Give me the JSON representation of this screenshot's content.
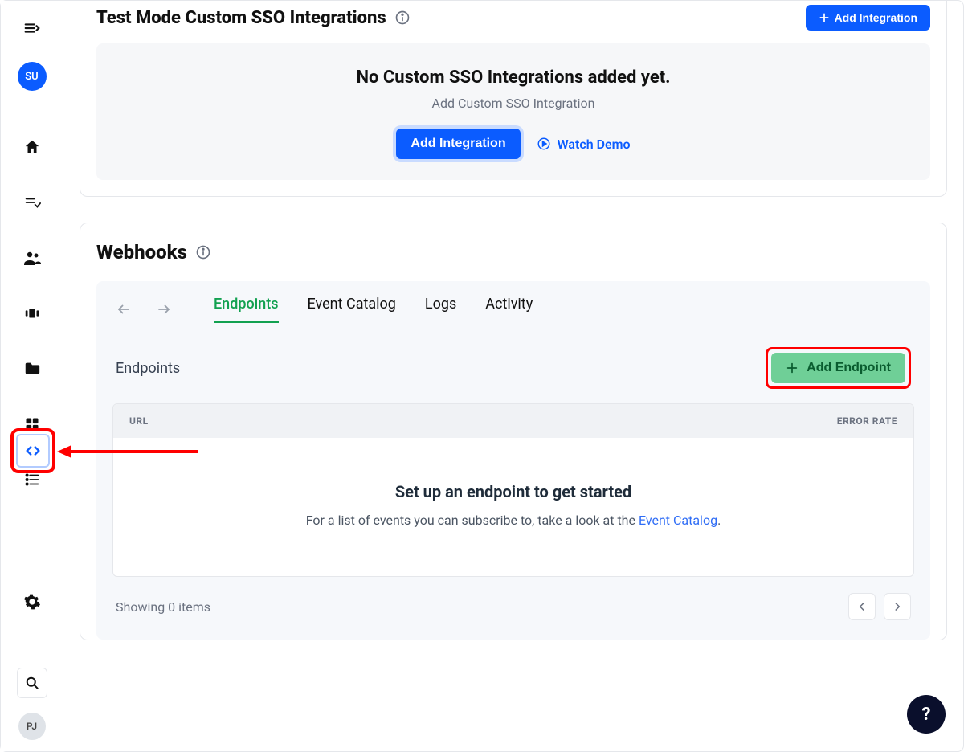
{
  "sidebar": {
    "avatar_top": "SU",
    "avatar_bottom": "PJ"
  },
  "sso": {
    "title": "Test Mode Custom SSO Integrations",
    "add_btn_top": "Add Integration",
    "empty_title": "No Custom SSO Integrations added yet.",
    "empty_sub": "Add Custom SSO Integration",
    "add_btn": "Add Integration",
    "watch_demo": "Watch Demo"
  },
  "webhooks": {
    "title": "Webhooks",
    "tabs": {
      "endpoints": "Endpoints",
      "event_catalog": "Event Catalog",
      "logs": "Logs",
      "activity": "Activity"
    },
    "endpoints_heading": "Endpoints",
    "add_endpoint": "Add Endpoint",
    "table": {
      "col_url": "URL",
      "col_error_rate": "ERROR RATE",
      "empty_title": "Set up an endpoint to get started",
      "empty_sub_prefix": "For a list of events you can subscribe to, take a look at the ",
      "empty_sub_link": "Event Catalog",
      "empty_sub_suffix": "."
    },
    "footer": {
      "showing": "Showing 0 items"
    }
  },
  "help": "?"
}
